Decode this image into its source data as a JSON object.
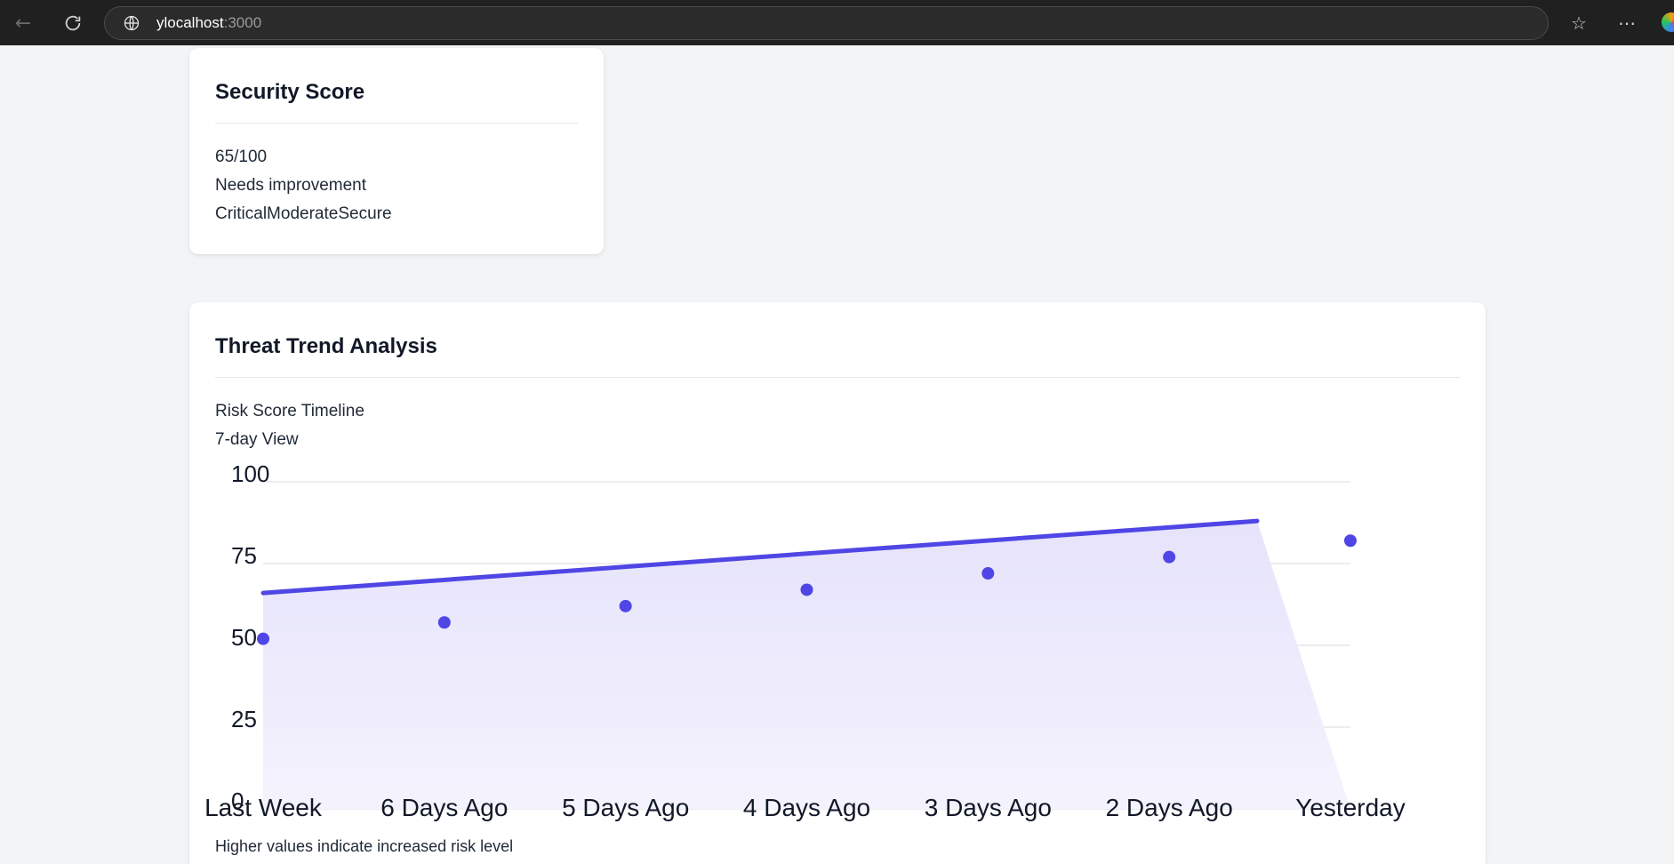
{
  "browser": {
    "url_host": "ylocalhost",
    "url_port": ":3000"
  },
  "security_score": {
    "title": "Security Score",
    "score": "65/100",
    "status": "Needs improvement",
    "scale_labels": "CriticalModerateSecure"
  },
  "threat_trend": {
    "title": "Threat Trend Analysis",
    "subtitle": "Risk Score Timeline",
    "view": "7-day View",
    "footnote": "Higher values indicate increased risk level"
  },
  "colors": {
    "accent": "#4f46e5",
    "area_fill": "#e8e6fb",
    "grid": "#e5e7eb"
  },
  "chart_data": {
    "type": "line",
    "categories": [
      "Last Week",
      "6 Days Ago",
      "5 Days Ago",
      "4 Days Ago",
      "3 Days Ago",
      "2 Days Ago",
      "Yesterday"
    ],
    "series": [
      {
        "values": [
          52,
          57,
          62,
          67,
          72,
          77,
          82
        ]
      }
    ],
    "trend_line": {
      "start": 66,
      "end": 88
    },
    "ylim": [
      0,
      100
    ],
    "yticks": [
      0,
      25,
      50,
      75,
      100
    ],
    "grid": true
  }
}
